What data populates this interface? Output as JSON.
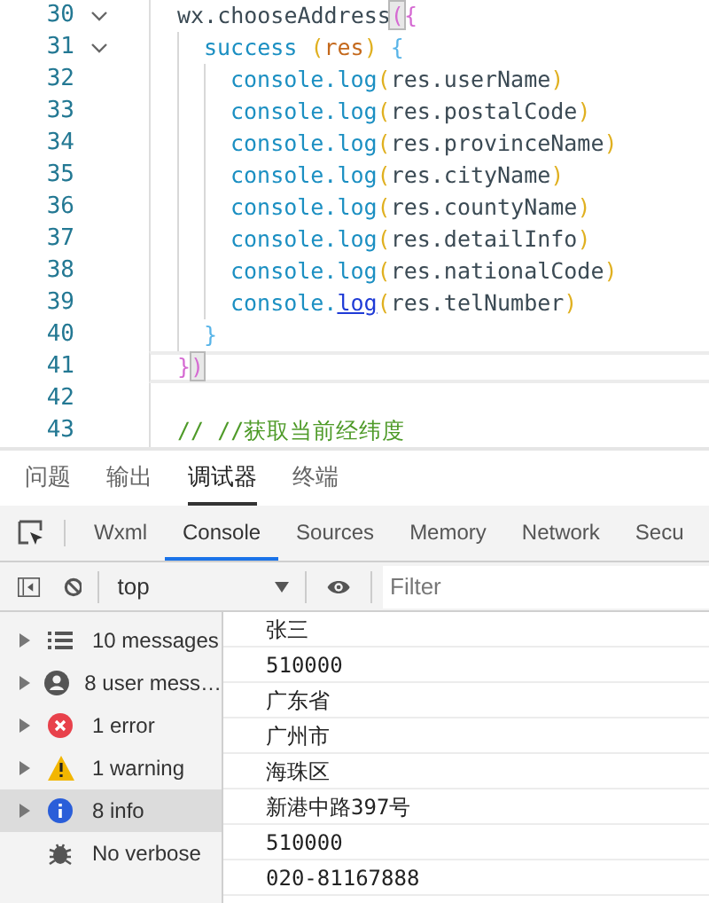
{
  "editor": {
    "lines": [
      {
        "number": "30",
        "foldable": true,
        "current": false,
        "tokens": [
          {
            "kind": "ident",
            "text": "wx.chooseAddress"
          },
          {
            "kind": "match",
            "text": "("
          },
          {
            "kind": "brace1",
            "text": "{"
          }
        ],
        "children": [
          {
            "number": "31",
            "foldable": true,
            "current": false,
            "tokens": [
              {
                "kind": "func",
                "text": "success "
              },
              {
                "kind": "paren",
                "text": "("
              },
              {
                "kind": "param",
                "text": "res"
              },
              {
                "kind": "paren",
                "text": ") "
              },
              {
                "kind": "brace2",
                "text": "{"
              }
            ],
            "children": [
              {
                "number": "32",
                "foldable": false,
                "current": false,
                "tokens": [
                  {
                    "kind": "func",
                    "text": "console.log"
                  },
                  {
                    "kind": "paren",
                    "text": "("
                  },
                  {
                    "kind": "ident",
                    "text": "res.userName"
                  },
                  {
                    "kind": "paren",
                    "text": ")"
                  }
                ]
              },
              {
                "number": "33",
                "foldable": false,
                "current": false,
                "tokens": [
                  {
                    "kind": "func",
                    "text": "console.log"
                  },
                  {
                    "kind": "paren",
                    "text": "("
                  },
                  {
                    "kind": "ident",
                    "text": "res.postalCode"
                  },
                  {
                    "kind": "paren",
                    "text": ")"
                  }
                ]
              },
              {
                "number": "34",
                "foldable": false,
                "current": false,
                "tokens": [
                  {
                    "kind": "func",
                    "text": "console.log"
                  },
                  {
                    "kind": "paren",
                    "text": "("
                  },
                  {
                    "kind": "ident",
                    "text": "res.provinceName"
                  },
                  {
                    "kind": "paren",
                    "text": ")"
                  }
                ]
              },
              {
                "number": "35",
                "foldable": false,
                "current": false,
                "tokens": [
                  {
                    "kind": "func",
                    "text": "console.log"
                  },
                  {
                    "kind": "paren",
                    "text": "("
                  },
                  {
                    "kind": "ident",
                    "text": "res.cityName"
                  },
                  {
                    "kind": "paren",
                    "text": ")"
                  }
                ]
              },
              {
                "number": "36",
                "foldable": false,
                "current": false,
                "tokens": [
                  {
                    "kind": "func",
                    "text": "console.log"
                  },
                  {
                    "kind": "paren",
                    "text": "("
                  },
                  {
                    "kind": "ident",
                    "text": "res.countyName"
                  },
                  {
                    "kind": "paren",
                    "text": ")"
                  }
                ]
              },
              {
                "number": "37",
                "foldable": false,
                "current": false,
                "tokens": [
                  {
                    "kind": "func",
                    "text": "console.log"
                  },
                  {
                    "kind": "paren",
                    "text": "("
                  },
                  {
                    "kind": "ident",
                    "text": "res.detailInfo"
                  },
                  {
                    "kind": "paren",
                    "text": ")"
                  }
                ]
              },
              {
                "number": "38",
                "foldable": false,
                "current": false,
                "tokens": [
                  {
                    "kind": "func",
                    "text": "console.log"
                  },
                  {
                    "kind": "paren",
                    "text": "("
                  },
                  {
                    "kind": "ident",
                    "text": "res.nationalCode"
                  },
                  {
                    "kind": "paren",
                    "text": ")"
                  }
                ]
              },
              {
                "number": "39",
                "foldable": false,
                "current": false,
                "tokens": [
                  {
                    "kind": "func",
                    "text": "console."
                  },
                  {
                    "kind": "link",
                    "text": "log"
                  },
                  {
                    "kind": "paren",
                    "text": "("
                  },
                  {
                    "kind": "ident",
                    "text": "res.telNumber"
                  },
                  {
                    "kind": "paren",
                    "text": ")"
                  }
                ]
              }
            ]
          },
          {
            "number": "40",
            "foldable": false,
            "current": false,
            "tokens": [
              {
                "kind": "brace2",
                "text": "}"
              }
            ]
          }
        ]
      },
      {
        "number": "41",
        "foldable": false,
        "current": true,
        "tokens": [
          {
            "kind": "brace1",
            "text": "}"
          },
          {
            "kind": "match",
            "text": ")"
          }
        ]
      },
      {
        "number": "42",
        "foldable": false,
        "current": false
      },
      {
        "number": "43",
        "foldable": false,
        "current": false,
        "tokens": [
          {
            "kind": "comment",
            "text": "// //获取当前经纬度"
          }
        ]
      }
    ]
  },
  "panel_tabs": [
    {
      "label": "问题",
      "selected": false
    },
    {
      "label": "输出",
      "selected": false
    },
    {
      "label": "调试器",
      "selected": true
    },
    {
      "label": "终端",
      "selected": false
    }
  ],
  "devtools_tabs": [
    {
      "label": "Wxml",
      "selected": false
    },
    {
      "label": "Console",
      "selected": true
    },
    {
      "label": "Sources",
      "selected": false
    },
    {
      "label": "Memory",
      "selected": false
    },
    {
      "label": "Network",
      "selected": false
    },
    {
      "label": "Secu",
      "selected": false
    }
  ],
  "toolbar": {
    "context": "top",
    "filter": {
      "placeholder": "Filter"
    }
  },
  "sidebar": [
    {
      "kind": "list",
      "label": "10 messages",
      "selected": false,
      "expandable": true
    },
    {
      "kind": "user",
      "label": "8 user mess…",
      "selected": false,
      "expandable": true
    },
    {
      "kind": "error",
      "label": "1 error",
      "selected": false,
      "expandable": true
    },
    {
      "kind": "warning",
      "label": "1 warning",
      "selected": false,
      "expandable": true
    },
    {
      "kind": "info",
      "label": "8 info",
      "selected": true,
      "expandable": true
    },
    {
      "kind": "verbose",
      "label": "No verbose",
      "selected": false,
      "expandable": false
    }
  ],
  "console_output": [
    "张三",
    "510000",
    "广东省",
    "广州市",
    "海珠区",
    "新港中路397号",
    "510000",
    "020-81167888"
  ]
}
